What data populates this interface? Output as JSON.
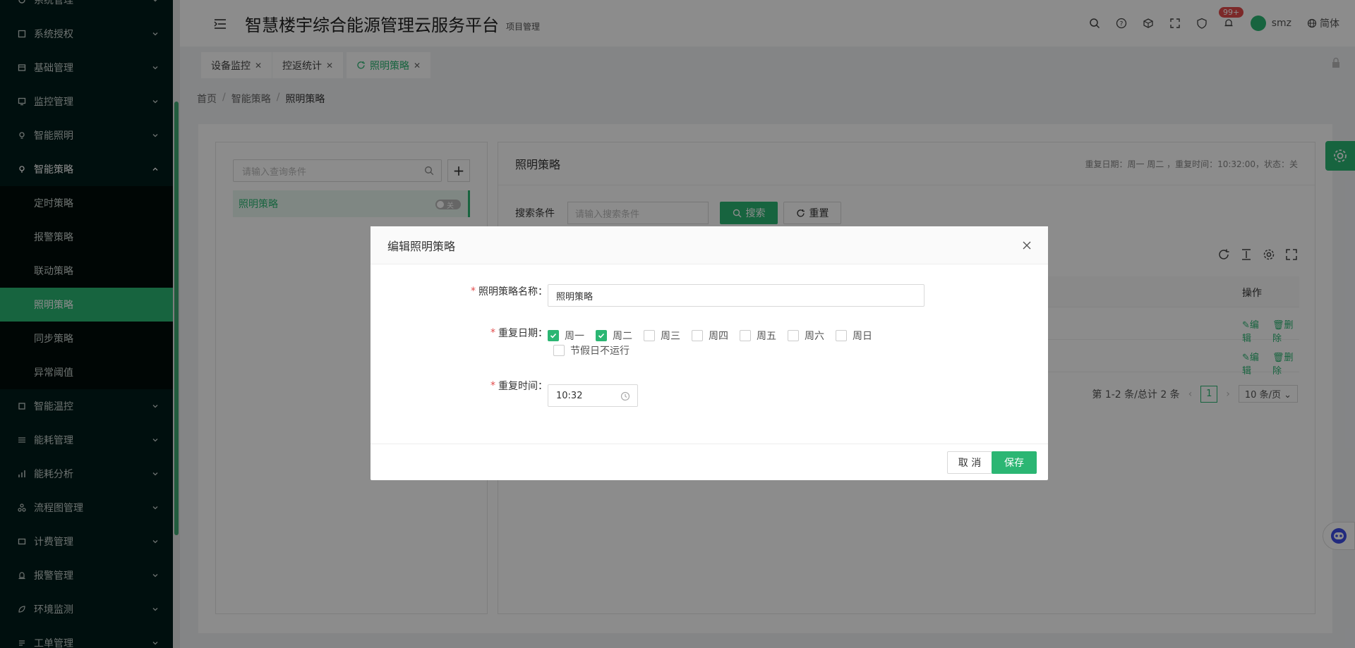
{
  "sidebar": {
    "items": [
      {
        "label": "系统管理",
        "icon": "gear-icon"
      },
      {
        "label": "系统授权",
        "icon": "license-icon"
      },
      {
        "label": "基础管理",
        "icon": "database-icon"
      },
      {
        "label": "监控管理",
        "icon": "monitor-icon"
      },
      {
        "label": "智能照明",
        "icon": "bulb-icon"
      },
      {
        "label": "智能策略",
        "icon": "strategy-icon"
      }
    ],
    "sub_items": [
      {
        "label": "定时策略"
      },
      {
        "label": "报警策略"
      },
      {
        "label": "联动策略"
      },
      {
        "label": "照明策略"
      },
      {
        "label": "同步策略"
      },
      {
        "label": "异常阈值"
      }
    ],
    "items_after": [
      {
        "label": "智能温控",
        "icon": "thermostat-icon"
      },
      {
        "label": "能耗管理",
        "icon": "sliders-icon"
      },
      {
        "label": "能耗分析",
        "icon": "bar-chart-icon"
      },
      {
        "label": "流程图管理",
        "icon": "flow-icon"
      },
      {
        "label": "计费管理",
        "icon": "billing-icon"
      },
      {
        "label": "报警管理",
        "icon": "alarm-icon"
      },
      {
        "label": "环境监测",
        "icon": "leaf-icon"
      },
      {
        "label": "工单管理",
        "icon": "ticket-icon"
      }
    ]
  },
  "header": {
    "title": "智慧楼宇综合能源管理云服务平台",
    "subtitle": "项目管理",
    "badge": "99+",
    "user": "smz",
    "language": "简体"
  },
  "tabs": [
    {
      "label": "设备监控"
    },
    {
      "label": "控返统计"
    },
    {
      "label": "照明策略"
    }
  ],
  "breadcrumb": [
    "首页",
    "智能策略",
    "照明策略"
  ],
  "left_panel": {
    "search_placeholder": "请输入查询条件",
    "tree_item": "照明策略",
    "toggle_text": "关"
  },
  "right_panel": {
    "title": "照明策略",
    "info": "重复日期：周一 周二 ，重复时间：10:32:00，状态：关",
    "search_label": "搜索条件",
    "search_placeholder": "请输入搜索条件",
    "search_btn": "搜索",
    "reset_btn": "重置",
    "col_op": "操作",
    "edit": "编辑",
    "delete": "删除",
    "pager_text": "第 1-2 条/总计 2 条",
    "page": "1",
    "page_size": "10 条/页"
  },
  "modal": {
    "title": "编辑照明策略",
    "name_label": "照明策略名称：",
    "name_value": "照明策略",
    "date_label": "重复日期：",
    "days": [
      {
        "label": "周一",
        "checked": true
      },
      {
        "label": "周二",
        "checked": true
      },
      {
        "label": "周三",
        "checked": false
      },
      {
        "label": "周四",
        "checked": false
      },
      {
        "label": "周五",
        "checked": false
      },
      {
        "label": "周六",
        "checked": false
      },
      {
        "label": "周日",
        "checked": false
      }
    ],
    "holiday_label": "节假日不运行",
    "time_label": "重复时间：",
    "time_value": "10:32",
    "cancel": "取 消",
    "save": "保存"
  },
  "colors": {
    "accent": "#2bb673",
    "sidebar_bg": "#001c1a",
    "required": "#e24c4c"
  }
}
